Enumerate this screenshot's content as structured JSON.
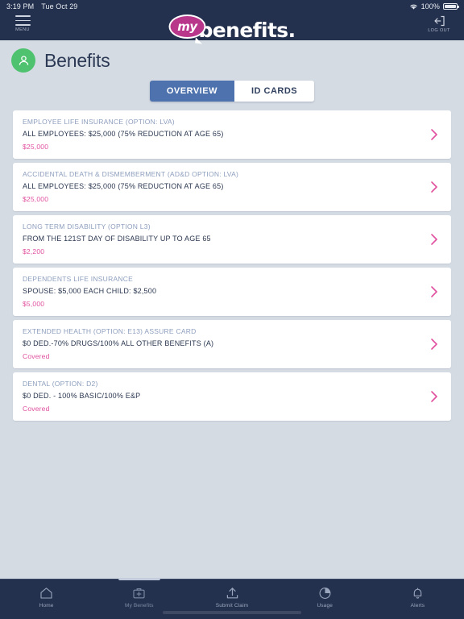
{
  "status_bar": {
    "time": "3:19 PM",
    "date": "Tue Oct 29",
    "battery_percent": "100%",
    "wifi_icon": "wifi-icon",
    "battery_icon": "battery-full-icon"
  },
  "header": {
    "menu_label": "MENU",
    "menu_icon": "hamburger-menu-icon",
    "logout_label": "LOG OUT",
    "logout_icon": "logout-icon",
    "logo_bubble_text": "my",
    "logo_word": "benefits.",
    "logo_bubble_color": "#b8378a",
    "background_color": "#24314e"
  },
  "page": {
    "title": "Benefits",
    "avatar_icon": "person-icon",
    "avatar_color": "#4ec26f",
    "background_color": "#d5dbe3"
  },
  "tabs": {
    "active_index": 0,
    "active_color": "#4d72ad",
    "items": [
      {
        "label": "OVERVIEW",
        "active": true
      },
      {
        "label": "ID CARDS",
        "active": false
      }
    ]
  },
  "benefits": {
    "accent_color": "#e0509f",
    "chevron_icon": "chevron-right-icon",
    "cards": [
      {
        "title": "EMPLOYEE LIFE INSURANCE (OPTION: LVA)",
        "detail": "ALL EMPLOYEES: $25,000 (75% REDUCTION AT AGE 65)",
        "value": "$25,000"
      },
      {
        "title": "ACCIDENTAL DEATH & DISMEMBERMENT (AD&D OPTION: LVA)",
        "detail": "ALL EMPLOYEES: $25,000 (75% REDUCTION AT AGE 65)",
        "value": "$25,000"
      },
      {
        "title": "LONG TERM DISABILITY (OPTION L3)",
        "detail": "FROM THE 121ST DAY OF DISABILITY UP TO AGE 65",
        "value": "$2,200"
      },
      {
        "title": "DEPENDENTS LIFE INSURANCE",
        "detail": "SPOUSE: $5,000   EACH CHILD: $2,500",
        "value": "$5,000"
      },
      {
        "title": "EXTENDED HEALTH (OPTION: E13) ASSURE CARD",
        "detail": "$0 DED.-70% DRUGS/100% ALL OTHER BENEFITS (A)",
        "value": "Covered"
      },
      {
        "title": "DENTAL (OPTION: D2)",
        "detail": "$0 DED. - 100% BASIC/100% E&P",
        "value": "Covered"
      }
    ]
  },
  "bottom_nav": {
    "active_index": 1,
    "items": [
      {
        "label": "Home",
        "icon": "home-icon",
        "active": false
      },
      {
        "label": "My Benefits",
        "icon": "medical-bag-icon",
        "active": true
      },
      {
        "label": "Submit Claim",
        "icon": "upload-icon",
        "active": false
      },
      {
        "label": "Usage",
        "icon": "pie-chart-icon",
        "active": false
      },
      {
        "label": "Alerts",
        "icon": "bell-icon",
        "active": false
      }
    ]
  }
}
